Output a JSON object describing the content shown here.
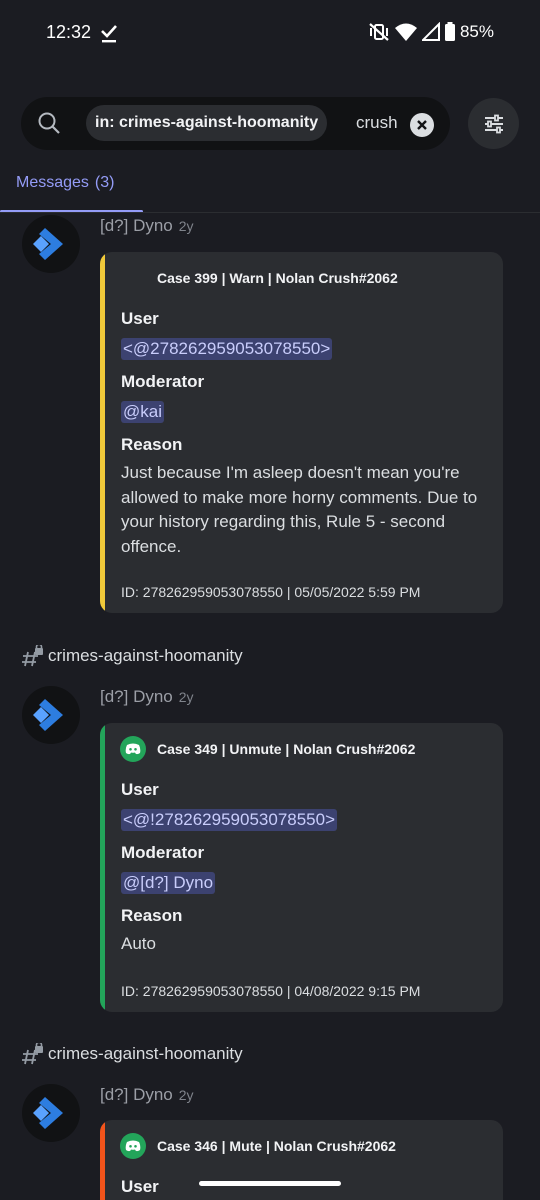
{
  "status_bar": {
    "time": "12:32",
    "battery": "85%"
  },
  "search": {
    "filter_chip": "in: crimes-against-hoomanity",
    "query": "crush"
  },
  "tab": {
    "label": "Messages",
    "count": "(3)"
  },
  "results": [
    {
      "channel": "",
      "author": "[d?] Dyno",
      "age": "2y",
      "embed": {
        "color": "#f0c93a",
        "title": "Case 399 | Warn | Nolan Crush#2062",
        "user_label": "User",
        "user_value": "<@278262959053078550>",
        "moderator_label": "Moderator",
        "moderator_value": "@kai",
        "reason_label": "Reason",
        "reason_value": "Just because I'm asleep doesn't mean you're allowed to make more horny comments. Due to your history regarding this, Rule 5 - second offence.",
        "footer": "ID: 278262959053078550 | 05/05/2022 5:59 PM"
      }
    },
    {
      "channel": "crimes-against-hoomanity",
      "author": "[d?] Dyno",
      "age": "2y",
      "embed": {
        "color": "#23a55a",
        "title": "Case 349 | Unmute | Nolan Crush#2062",
        "user_label": "User",
        "user_value": "<@!278262959053078550>",
        "moderator_label": "Moderator",
        "moderator_value": "@[d?] Dyno",
        "reason_label": "Reason",
        "reason_value": "Auto",
        "footer": "ID: 278262959053078550 | 04/08/2022 9:15 PM"
      }
    },
    {
      "channel": "crimes-against-hoomanity",
      "author": "[d?] Dyno",
      "age": "2y",
      "embed": {
        "color": "#f2541b",
        "title": "Case 346 | Mute | Nolan Crush#2062",
        "user_label": "User"
      }
    }
  ],
  "colors": {
    "background": "#1b1c22",
    "embed_bg": "#2b2d31",
    "accent": "#949cf7",
    "mention_bg": "#3c4270",
    "dyno_blue": "#2d7de0",
    "discord_green": "#23a55a"
  }
}
